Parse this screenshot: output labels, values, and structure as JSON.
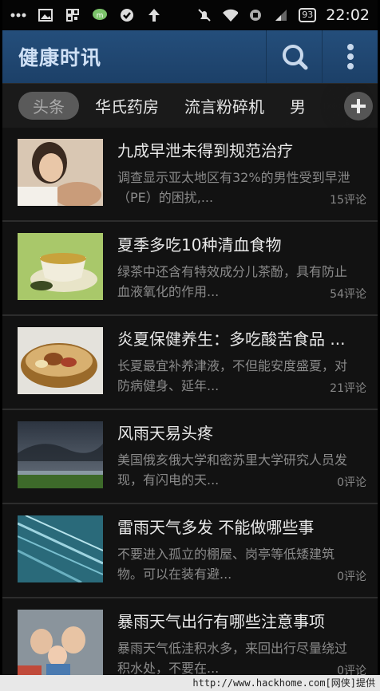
{
  "status_bar": {
    "icons_left": [
      "more-dots-icon",
      "image-icon",
      "qr-icon",
      "wechat-icon",
      "check-circle-icon",
      "upload-arrow-icon"
    ],
    "icons_right": [
      "mute-icon",
      "wifi-icon",
      "sim-icon",
      "signal-icon"
    ],
    "battery": "93",
    "time": "22:02"
  },
  "header": {
    "title": "健康时讯",
    "search_icon": "search-icon",
    "menu_icon": "more-vert-icon"
  },
  "tabs": [
    {
      "label": "头条",
      "active": true
    },
    {
      "label": "华氏药房",
      "active": false
    },
    {
      "label": "流言粉碎机",
      "active": false
    },
    {
      "label": "男",
      "active": false
    }
  ],
  "news": [
    {
      "title": "九成早泄未得到规范治疗",
      "desc": "调查显示亚太地区有32%的男性受到早泄（PE）的困扰,...",
      "comments": "15评论"
    },
    {
      "title": "夏季多吃10种清血食物",
      "desc": "绿茶中还含有特效成分儿茶酚，具有防止血液氧化的作用...",
      "comments": "54评论"
    },
    {
      "title": "炎夏保健养生：多吃酸苦食品 ...",
      "desc": "长夏最宜补养津液，不但能安度盛夏，对防病健身、延年...",
      "comments": "21评论"
    },
    {
      "title": "风雨天易头疼",
      "desc": "美国俄亥俄大学和密苏里大学研究人员发现，有闪电的天...",
      "comments": "0评论"
    },
    {
      "title": "雷雨天气多发 不能做哪些事",
      "desc": "不要进入孤立的棚屋、岗亭等低矮建筑物。可以在装有避...",
      "comments": "0评论"
    },
    {
      "title": "暴雨天气出行有哪些注意事项",
      "desc": "暴雨天气低洼积水多，来回出行尽量绕过积水处，不要在...",
      "comments": "0评论"
    }
  ],
  "footer": {
    "text": "http://www.hackhome.com[网侠]提供"
  }
}
